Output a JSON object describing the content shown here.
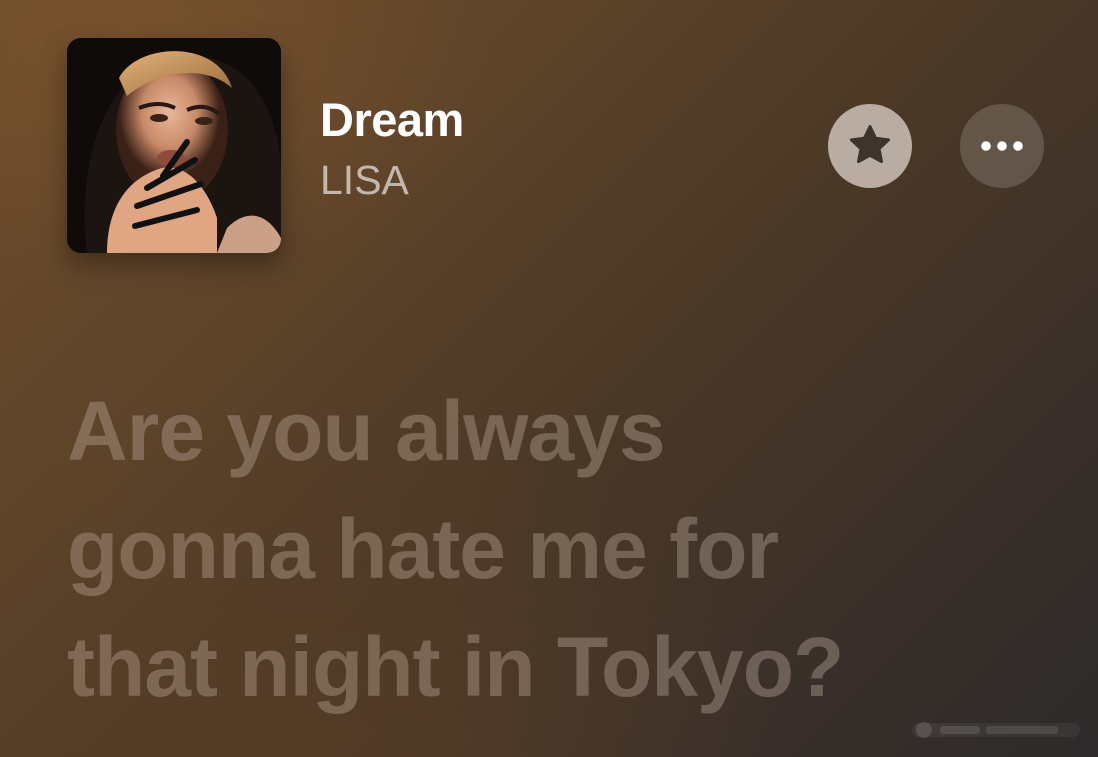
{
  "track": {
    "title": "Dream",
    "artist": "LISA"
  },
  "controls": {
    "favorite_icon": "star-icon",
    "more_icon": "ellipsis-icon"
  },
  "lyrics": {
    "current_lines": [
      "Are you always",
      "gonna hate me for",
      "that night in Tokyo?"
    ]
  },
  "colors": {
    "title": "#ffffff",
    "artist": "#a99a8c",
    "lyric_inactive": "#6d5d51",
    "favorite_button_bg": "#c9bdb5",
    "star_fill": "#3d342d"
  }
}
